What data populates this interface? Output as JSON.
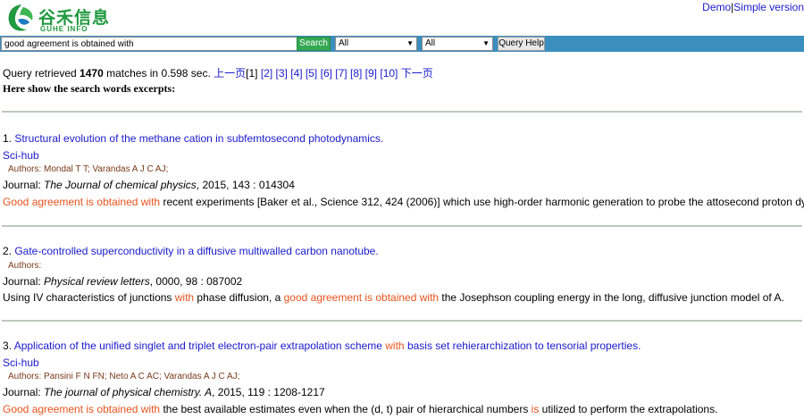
{
  "header": {
    "logo_cn": "谷禾信息",
    "logo_en": "GUHE INFO",
    "links": [
      "Demo",
      "|",
      "Simple version"
    ]
  },
  "search": {
    "query": "good agreement is obtained with",
    "button": "Search",
    "select1": "All",
    "select2": "All",
    "help": "Query Help"
  },
  "summary": {
    "prefix": "Query retrieved ",
    "count": "1470",
    "middle": " matches in 0.598 sec. ",
    "prev": "上一页",
    "pages": [
      "[1]",
      "[2]",
      "[3]",
      "[4]",
      "[5]",
      "[6]",
      "[7]",
      "[8]",
      "[9]",
      "[10]"
    ],
    "next": "下一页",
    "excerpt_heading": "Here show the search words excerpts:"
  },
  "results": [
    {
      "num": "1. ",
      "title": "Structural evolution of the methane cation in subfemtosecond photodynamics.",
      "link": "Sci-hub",
      "authors_label": "Authors: ",
      "authors": "Mondal T T; Varandas A J C AJ;",
      "journal_label": "Journal: ",
      "journal": "The Journal of chemical physics",
      "journal_info": ", 2015, 143 : 014304",
      "snippet_hl": "Good agreement is obtained with",
      "snippet_rest": " recent experiments [Baker et al., Science 312, 424 (2006)] which use high-order harmonic generation to probe the attosecond proton dynamics."
    },
    {
      "num": "2. ",
      "title": "Gate-controlled superconductivity in a diffusive multiwalled carbon nanotube.",
      "authors_label": "Authors:",
      "journal_label": "Journal: ",
      "journal": "Physical review letters",
      "journal_info": ", 0000, 98 : 087002",
      "snippet_a": "Using IV characteristics of junctions ",
      "snippet_hl1": "with",
      "snippet_b": " phase diffusion, a ",
      "snippet_hl2": "good agreement is obtained with",
      "snippet_c": " the Josephson coupling energy in the long, diffusive junction model of A."
    },
    {
      "num": "3. ",
      "title_a": "Application of the unified singlet and triplet electron-pair extrapolation scheme ",
      "title_hl": "with",
      "title_b": " basis set rehierarchization to tensorial properties.",
      "link": "Sci-hub",
      "authors_label": "Authors: ",
      "authors": "Pansini F N FN; Neto A C AC; Varandas A J C AJ;",
      "journal_label": "Journal: ",
      "journal": "The journal of physical chemistry. A",
      "journal_info": ", 2015, 119 : 1208-1217",
      "snippet_hl1": "Good agreement is obtained with",
      "snippet_a": " the best available estimates even when the (d, t) pair of hierarchical numbers ",
      "snippet_hl2": "is",
      "snippet_b": " utilized to perform the extrapolations."
    }
  ],
  "colors": {
    "bar": "#3a8fbf",
    "search_button": "#34a853",
    "highlight": "#e8531e",
    "link": "#1a1acc",
    "brand": "#1f9a3e"
  }
}
